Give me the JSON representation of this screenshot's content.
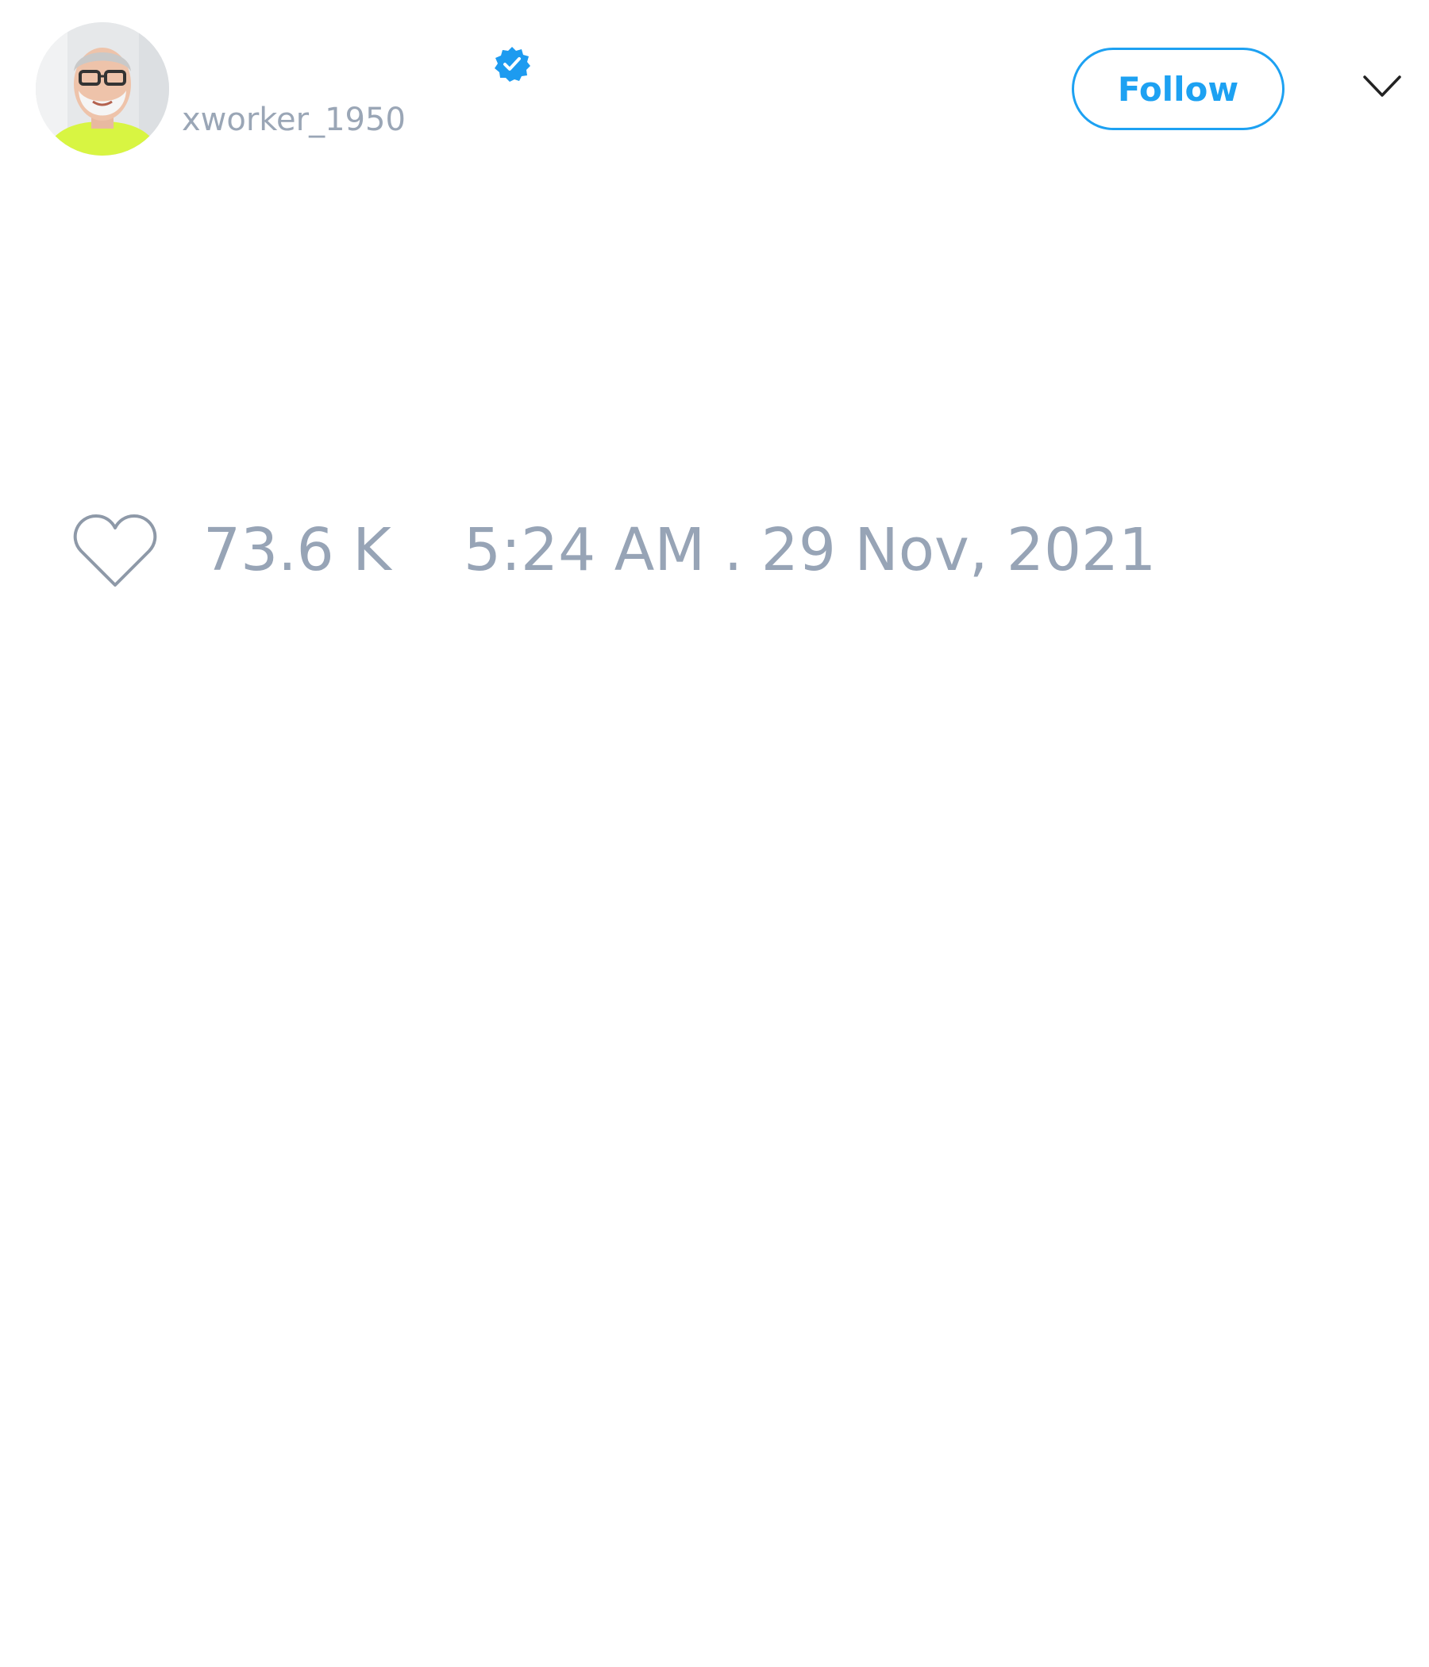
{
  "tweet": {
    "author": {
      "handle": "xworker_1950",
      "avatar_icon": "user-photo",
      "verified": true,
      "verified_icon": "verified-badge-icon"
    },
    "follow_label": "Follow",
    "menu_icon": "chevron-down-icon",
    "like_icon": "heart-outline-icon",
    "like_count": "73.6 K",
    "timestamp": "5:24 AM . 29 Nov, 2021"
  },
  "colors": {
    "accent": "#1da1f2",
    "muted_text": "#97a4b6",
    "background": "#ffffff"
  }
}
